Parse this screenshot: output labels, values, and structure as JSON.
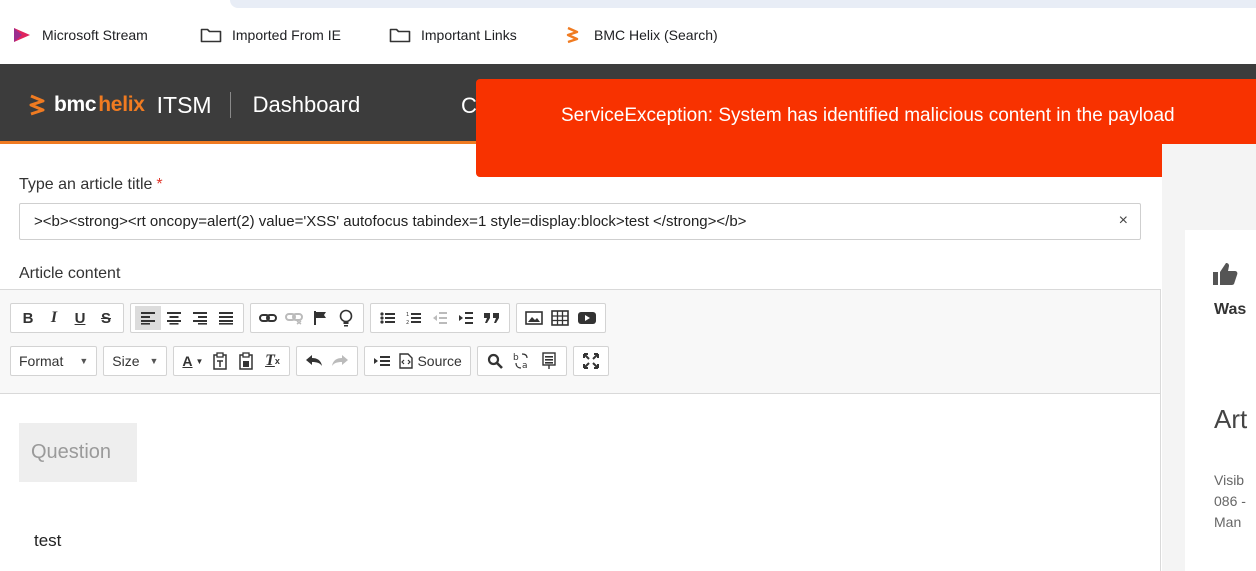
{
  "bookmarks": [
    {
      "label": "Microsoft Stream",
      "icon": "microsoft-stream-icon"
    },
    {
      "label": "Imported From IE",
      "icon": "folder-icon"
    },
    {
      "label": "Important Links",
      "icon": "folder-icon"
    },
    {
      "label": "BMC Helix (Search)",
      "icon": "bmc-helix-icon"
    }
  ],
  "header": {
    "logo_bmc": "bmc",
    "logo_helix": "helix",
    "product": "ITSM",
    "nav_dashboard": "Dashboard",
    "nav_partial": "C"
  },
  "toast": {
    "message": "ServiceException: System has identified malicious content in the payload"
  },
  "form": {
    "title_label": "Type an article title",
    "required_marker": "*",
    "title_value": "><b><strong><rt oncopy=alert(2) value='XSS' autofocus tabindex=1 style=display:block>test </strong></b>",
    "clear_symbol": "×",
    "content_label": "Article content"
  },
  "toolbar": {
    "bold": "B",
    "italic": "I",
    "underline": "U",
    "strike": "S",
    "format_label": "Format",
    "size_label": "Size",
    "font_color_label": "A",
    "remove_format": "T",
    "source_label": "Source"
  },
  "editor": {
    "question_label": "Question",
    "body_text": "test"
  },
  "right_panel": {
    "was_text": "Was",
    "article_heading": "Art",
    "visibility_line1": "Visib",
    "visibility_line2": "086 -",
    "visibility_line3": "Man"
  },
  "colors": {
    "header_bg": "#3c3c3c",
    "accent_orange": "#f07b21",
    "toast_bg": "#f83200",
    "required_red": "#e0362a"
  }
}
